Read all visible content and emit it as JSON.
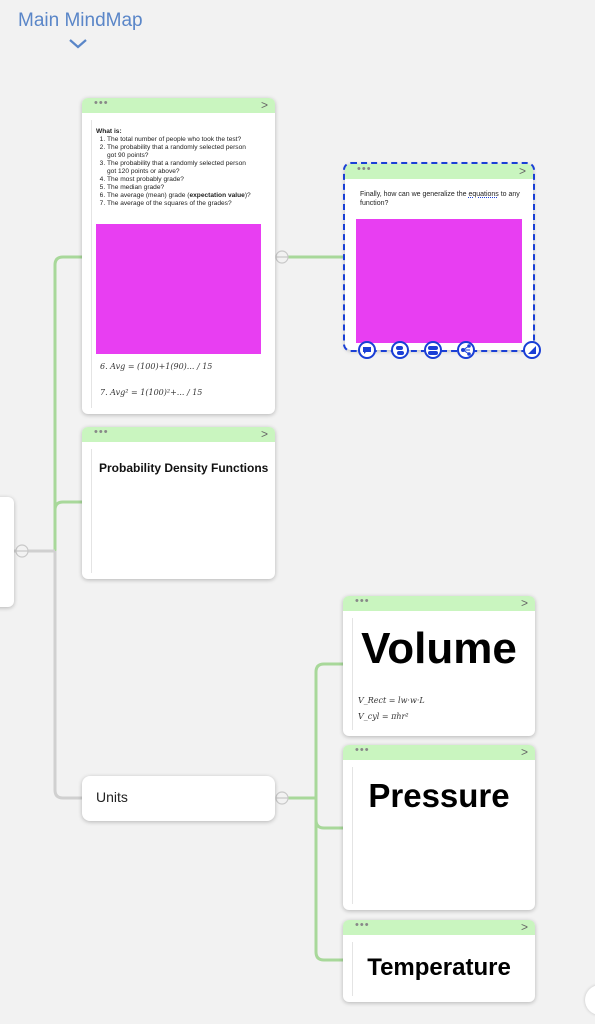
{
  "header": {
    "title": "Main MindMap"
  },
  "cards": {
    "questions": {
      "heading": "What is:",
      "items": [
        "The total number of people who took the test?",
        "The probability that a randomly selected person got 90 points?",
        "The probability that a randomly selected person got 120 points or above?",
        "The most probably grade?",
        "The median grade?",
        "The average (mean) grade (expectation value)?",
        "The average of the squares of the grades?"
      ],
      "item6_bold": "expectation value",
      "handwriting_1": "6. Avg = (100)+1(90)... / 15",
      "handwriting_2": "7. Avg² = 1(100)²+... / 15"
    },
    "generalize": {
      "text_before": "Finally, how can we generalize the ",
      "text_link": "equations",
      "text_after": " to any function?"
    },
    "pdf": {
      "title": "Probability Density Functions"
    },
    "volume": {
      "title": "Volume",
      "handwriting_1": "V_Rect = lw·w·L",
      "handwriting_2": "V_cyl = πhr²"
    },
    "pressure": {
      "title": "Pressure"
    },
    "temperature": {
      "title": "Temperature"
    }
  },
  "units_node": {
    "label": "Units"
  },
  "colors": {
    "card_header": "#c9f5bf",
    "connector": "#a8d89a",
    "magenta": "#e83ef2",
    "selection": "#1a3fd6",
    "title": "#5a86c8"
  },
  "toolbar": {
    "icons": [
      "comment-icon",
      "toggle-icon",
      "pill-icon",
      "share-icon",
      "resize-icon"
    ]
  }
}
